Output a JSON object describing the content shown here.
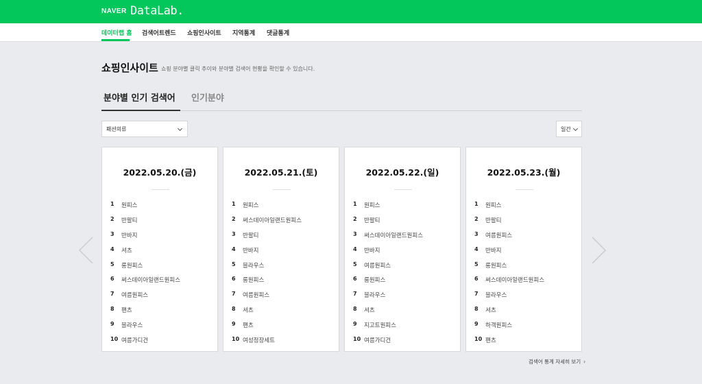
{
  "header": {
    "brand_naver": "NAVER",
    "brand_datalab": "DataLab."
  },
  "nav": {
    "items": [
      {
        "label": "데이터랩 홈"
      },
      {
        "label": "검색어트렌드"
      },
      {
        "label": "쇼핑인사이트"
      },
      {
        "label": "지역통계"
      },
      {
        "label": "댓글통계"
      }
    ]
  },
  "page": {
    "title": "쇼핑인사이트",
    "description": "쇼핑 분야별 클릭 추이와 분야별 검색어 현황을 확인할 수 있습니다."
  },
  "tabs": [
    {
      "label": "분야별 인기 검색어"
    },
    {
      "label": "인기분야"
    }
  ],
  "filters": {
    "category": "패션의류",
    "period": "일간"
  },
  "cards": [
    {
      "date": "2022.05.20.(금)",
      "items": [
        {
          "rank": "1",
          "keyword": "원피스"
        },
        {
          "rank": "2",
          "keyword": "반팔티"
        },
        {
          "rank": "3",
          "keyword": "반바지"
        },
        {
          "rank": "4",
          "keyword": "셔츠"
        },
        {
          "rank": "5",
          "keyword": "롱원피스"
        },
        {
          "rank": "6",
          "keyword": "써스데이아일랜드원피스"
        },
        {
          "rank": "7",
          "keyword": "여름원피스"
        },
        {
          "rank": "8",
          "keyword": "팬츠"
        },
        {
          "rank": "9",
          "keyword": "블라우스"
        },
        {
          "rank": "10",
          "keyword": "여름가디건"
        }
      ]
    },
    {
      "date": "2022.05.21.(토)",
      "items": [
        {
          "rank": "1",
          "keyword": "원피스"
        },
        {
          "rank": "2",
          "keyword": "써스데이아일랜드원피스"
        },
        {
          "rank": "3",
          "keyword": "반팔티"
        },
        {
          "rank": "4",
          "keyword": "반바지"
        },
        {
          "rank": "5",
          "keyword": "블라우스"
        },
        {
          "rank": "6",
          "keyword": "롱원피스"
        },
        {
          "rank": "7",
          "keyword": "여름원피스"
        },
        {
          "rank": "8",
          "keyword": "셔츠"
        },
        {
          "rank": "9",
          "keyword": "팬츠"
        },
        {
          "rank": "10",
          "keyword": "여성정장세트"
        }
      ]
    },
    {
      "date": "2022.05.22.(일)",
      "items": [
        {
          "rank": "1",
          "keyword": "원피스"
        },
        {
          "rank": "2",
          "keyword": "반팔티"
        },
        {
          "rank": "3",
          "keyword": "써스데이아일랜드원피스"
        },
        {
          "rank": "4",
          "keyword": "반바지"
        },
        {
          "rank": "5",
          "keyword": "여름원피스"
        },
        {
          "rank": "6",
          "keyword": "롱원피스"
        },
        {
          "rank": "7",
          "keyword": "블라우스"
        },
        {
          "rank": "8",
          "keyword": "셔츠"
        },
        {
          "rank": "9",
          "keyword": "지고트원피스"
        },
        {
          "rank": "10",
          "keyword": "여름가디건"
        }
      ]
    },
    {
      "date": "2022.05.23.(월)",
      "items": [
        {
          "rank": "1",
          "keyword": "원피스"
        },
        {
          "rank": "2",
          "keyword": "반팔티"
        },
        {
          "rank": "3",
          "keyword": "여름원피스"
        },
        {
          "rank": "4",
          "keyword": "반바지"
        },
        {
          "rank": "5",
          "keyword": "롱원피스"
        },
        {
          "rank": "6",
          "keyword": "써스데이아일랜드원피스"
        },
        {
          "rank": "7",
          "keyword": "블라우스"
        },
        {
          "rank": "8",
          "keyword": "셔츠"
        },
        {
          "rank": "9",
          "keyword": "하객원피스"
        },
        {
          "rank": "10",
          "keyword": "팬츠"
        }
      ]
    }
  ],
  "more_link": "검색어 통계 자세히 보기",
  "icons": {
    "prev": "chevron-left-icon",
    "next": "chevron-right-icon",
    "dropdown": "chevron-down-icon"
  },
  "colors": {
    "brand_green": "#03c75a",
    "background": "#e9ebee"
  }
}
